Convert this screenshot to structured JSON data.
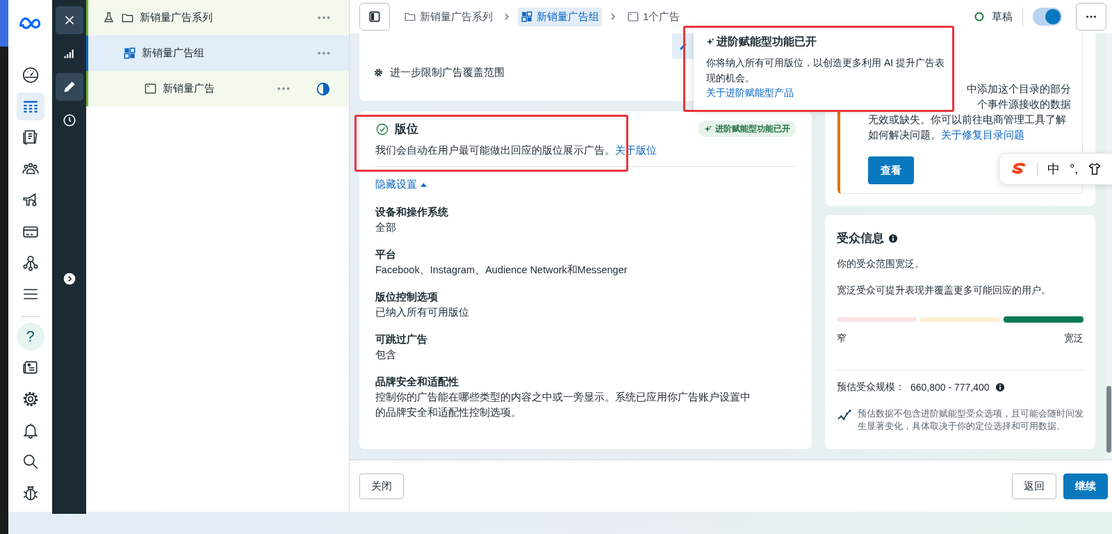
{
  "nav_rail": {
    "items": [
      {
        "kind": "gauge",
        "selected": false
      },
      {
        "kind": "table",
        "selected": true
      },
      {
        "kind": "pages",
        "selected": false
      },
      {
        "kind": "people",
        "selected": false
      },
      {
        "kind": "megaphone",
        "selected": false
      },
      {
        "kind": "card",
        "selected": false
      },
      {
        "kind": "network",
        "selected": false
      },
      {
        "kind": "menu",
        "selected": false
      }
    ],
    "bottom_items": [
      {
        "kind": "help",
        "label": "?",
        "selected": true
      },
      {
        "kind": "news",
        "selected": false
      },
      {
        "kind": "gear",
        "selected": false
      },
      {
        "kind": "bell",
        "selected": false
      },
      {
        "kind": "search",
        "selected": false
      },
      {
        "kind": "bug",
        "selected": false
      }
    ]
  },
  "tool_rail": {
    "items": [
      {
        "kind": "close",
        "selected": true
      },
      {
        "kind": "chart",
        "selected": false
      },
      {
        "kind": "edit",
        "selected": true
      },
      {
        "kind": "history",
        "selected": false
      }
    ]
  },
  "tree": [
    {
      "kind": "campaign",
      "label": "新销量广告系列",
      "selected": false,
      "children": [
        {
          "kind": "adset",
          "label": "新销量广告组",
          "selected": true,
          "children": [
            {
              "kind": "ad",
              "label": "新销量广告",
              "selected": false
            }
          ]
        }
      ]
    }
  ],
  "breadcrumb": [
    {
      "kind": "campaign",
      "label": "新销量广告系列",
      "selected": false
    },
    {
      "kind": "adset",
      "label": "新销量广告组",
      "selected": true
    },
    {
      "kind": "ad",
      "label": "1个广告",
      "selected": false
    }
  ],
  "status": {
    "label": "草稿"
  },
  "publish_toggle": {
    "on": true
  },
  "top_card": {
    "item": "进一步限制广告覆盖范围"
  },
  "placements": {
    "title": "版位",
    "description": "我们会自动在用户最可能做出回应的版位展示广告。",
    "link": "关于版位",
    "badge": "进阶赋能型功能已开",
    "toggle_label": "隐藏设置",
    "expanded": true,
    "settings": [
      {
        "label": "设备和操作系统",
        "value": "全部"
      },
      {
        "label": "平台",
        "value": "Facebook、Instagram、Audience Network和Messenger"
      },
      {
        "label": "版位控制选项",
        "value": "已纳入所有可用版位"
      },
      {
        "label": "可跳过广告",
        "value": "包含"
      },
      {
        "label": "品牌安全和适配性",
        "value": "控制你的广告能在哪些类型的内容之中或一旁显示。系统已应用你广告账户设置中的品牌安全和适配性控制选项。"
      }
    ]
  },
  "warning": {
    "cut_lines": [
      "中添加这个目录的部分",
      "个事件源接收的数据"
    ],
    "text": "无效或缺失。你可以前往电商管理工具了解如何解决问题。",
    "link": "关于修复目录问题",
    "button": "查看"
  },
  "audience": {
    "title": "受众信息",
    "description": "你的受众范围宽泛。",
    "hint": "宽泛受众可提升表现并覆盖更多可能回应的用户。",
    "meter": [
      {
        "color": "#fbe3e6",
        "selected": false
      },
      {
        "color": "#fcf0d2",
        "selected": false
      },
      {
        "color": "#0b7a52",
        "selected": true
      }
    ],
    "min_label": "窄",
    "max_label": "宽泛",
    "size_label": "预估受众规模：",
    "size_value": "660,800 - 777,400",
    "note": "预估数据不包含进阶赋能型受众选项，且可能会随时间发生显著变化，具体取决于你的定位选择和可用数据。"
  },
  "popover": {
    "title": "进阶赋能型功能已开",
    "body": "你将纳入所有可用版位，以创造更多利用 AI 提升广告表现的机会。",
    "link": "关于进阶赋能型产品"
  },
  "footer": {
    "buttons": [
      {
        "label": "关闭",
        "kind": "secondary"
      },
      {
        "label": "返回",
        "kind": "secondary"
      },
      {
        "label": "继续",
        "kind": "primary"
      }
    ]
  },
  "ime_bar": {
    "items": [
      {
        "kind": "logo"
      },
      {
        "kind": "text",
        "label": "中"
      },
      {
        "kind": "text",
        "label": "°,"
      },
      {
        "kind": "skin"
      }
    ]
  }
}
